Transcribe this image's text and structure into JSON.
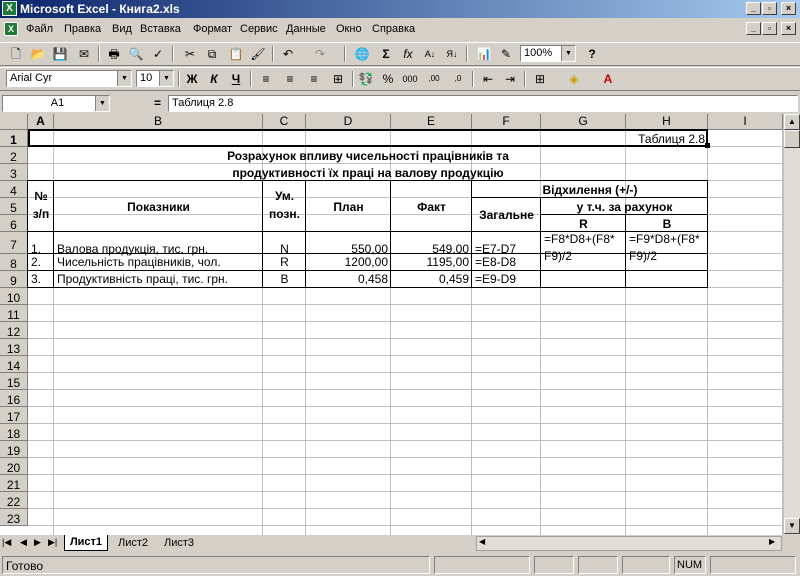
{
  "window": {
    "title": "Microsoft Excel - Книга2.xls",
    "app_icon": "excel-icon",
    "buttons": {
      "minimize": "_",
      "maximize": "▫",
      "close": "×"
    }
  },
  "menu": [
    "Файл",
    "Правка",
    "Вид",
    "Вставка",
    "Формат",
    "Сервис",
    "Данные",
    "Окно",
    "Справка"
  ],
  "toolbar": {
    "zoom": "100%",
    "font": "Arial Cyr",
    "size": "10",
    "bold": "Ж",
    "italic": "К",
    "underline": "Ч"
  },
  "formula_bar": {
    "name_box": "A1",
    "eq": "=",
    "content": "Таблиця 2.8"
  },
  "columns": [
    "A",
    "B",
    "C",
    "D",
    "E",
    "F",
    "G",
    "H",
    "I"
  ],
  "rows": [
    "1",
    "2",
    "3",
    "4",
    "5",
    "6",
    "7",
    "8",
    "9",
    "10",
    "11",
    "12",
    "13",
    "14",
    "15",
    "16",
    "17",
    "18",
    "19",
    "20",
    "21",
    "22",
    "23"
  ],
  "sheet": {
    "r1": "Таблиця 2.8",
    "title1": "Розрахунок впливу чисельності працівників та",
    "title2": "продуктивності їх праці на валову продукцію",
    "h_num1": "№",
    "h_num2": "з/п",
    "h_ind": "Показники",
    "h_um1": "Ум.",
    "h_um2": "позн.",
    "h_plan": "План",
    "h_fact": "Факт",
    "h_dev": "Відхилення (+/-)",
    "h_total": "Загальне",
    "h_incl": "у т.ч. за рахунок",
    "h_R": "R",
    "h_B": "B",
    "r7": {
      "n": "1.",
      "name": "Валова продукція, тис. грн.",
      "sym": "N",
      "plan": "550,00",
      "fact": "549,00",
      "tot": "=E7-D7",
      "g1": "=F8*D8+(F8*",
      "g2": "F9)/2",
      "h1": "=F9*D8+(F8*",
      "h2": "F9)/2"
    },
    "r8": {
      "n": "2.",
      "name": "Чисельність працівників, чол.",
      "sym": "R",
      "plan": "1200,00",
      "fact": "1195,00",
      "tot": "=E8-D8"
    },
    "r9": {
      "n": "3.",
      "name": "Продуктивність праці, тис. грн.",
      "sym": "B",
      "plan": "0,458",
      "fact": "0,459",
      "tot": "=E9-D9"
    }
  },
  "tabs": [
    "Лист1",
    "Лист2",
    "Лист3"
  ],
  "status": {
    "ready": "Готово",
    "num": "NUM"
  }
}
